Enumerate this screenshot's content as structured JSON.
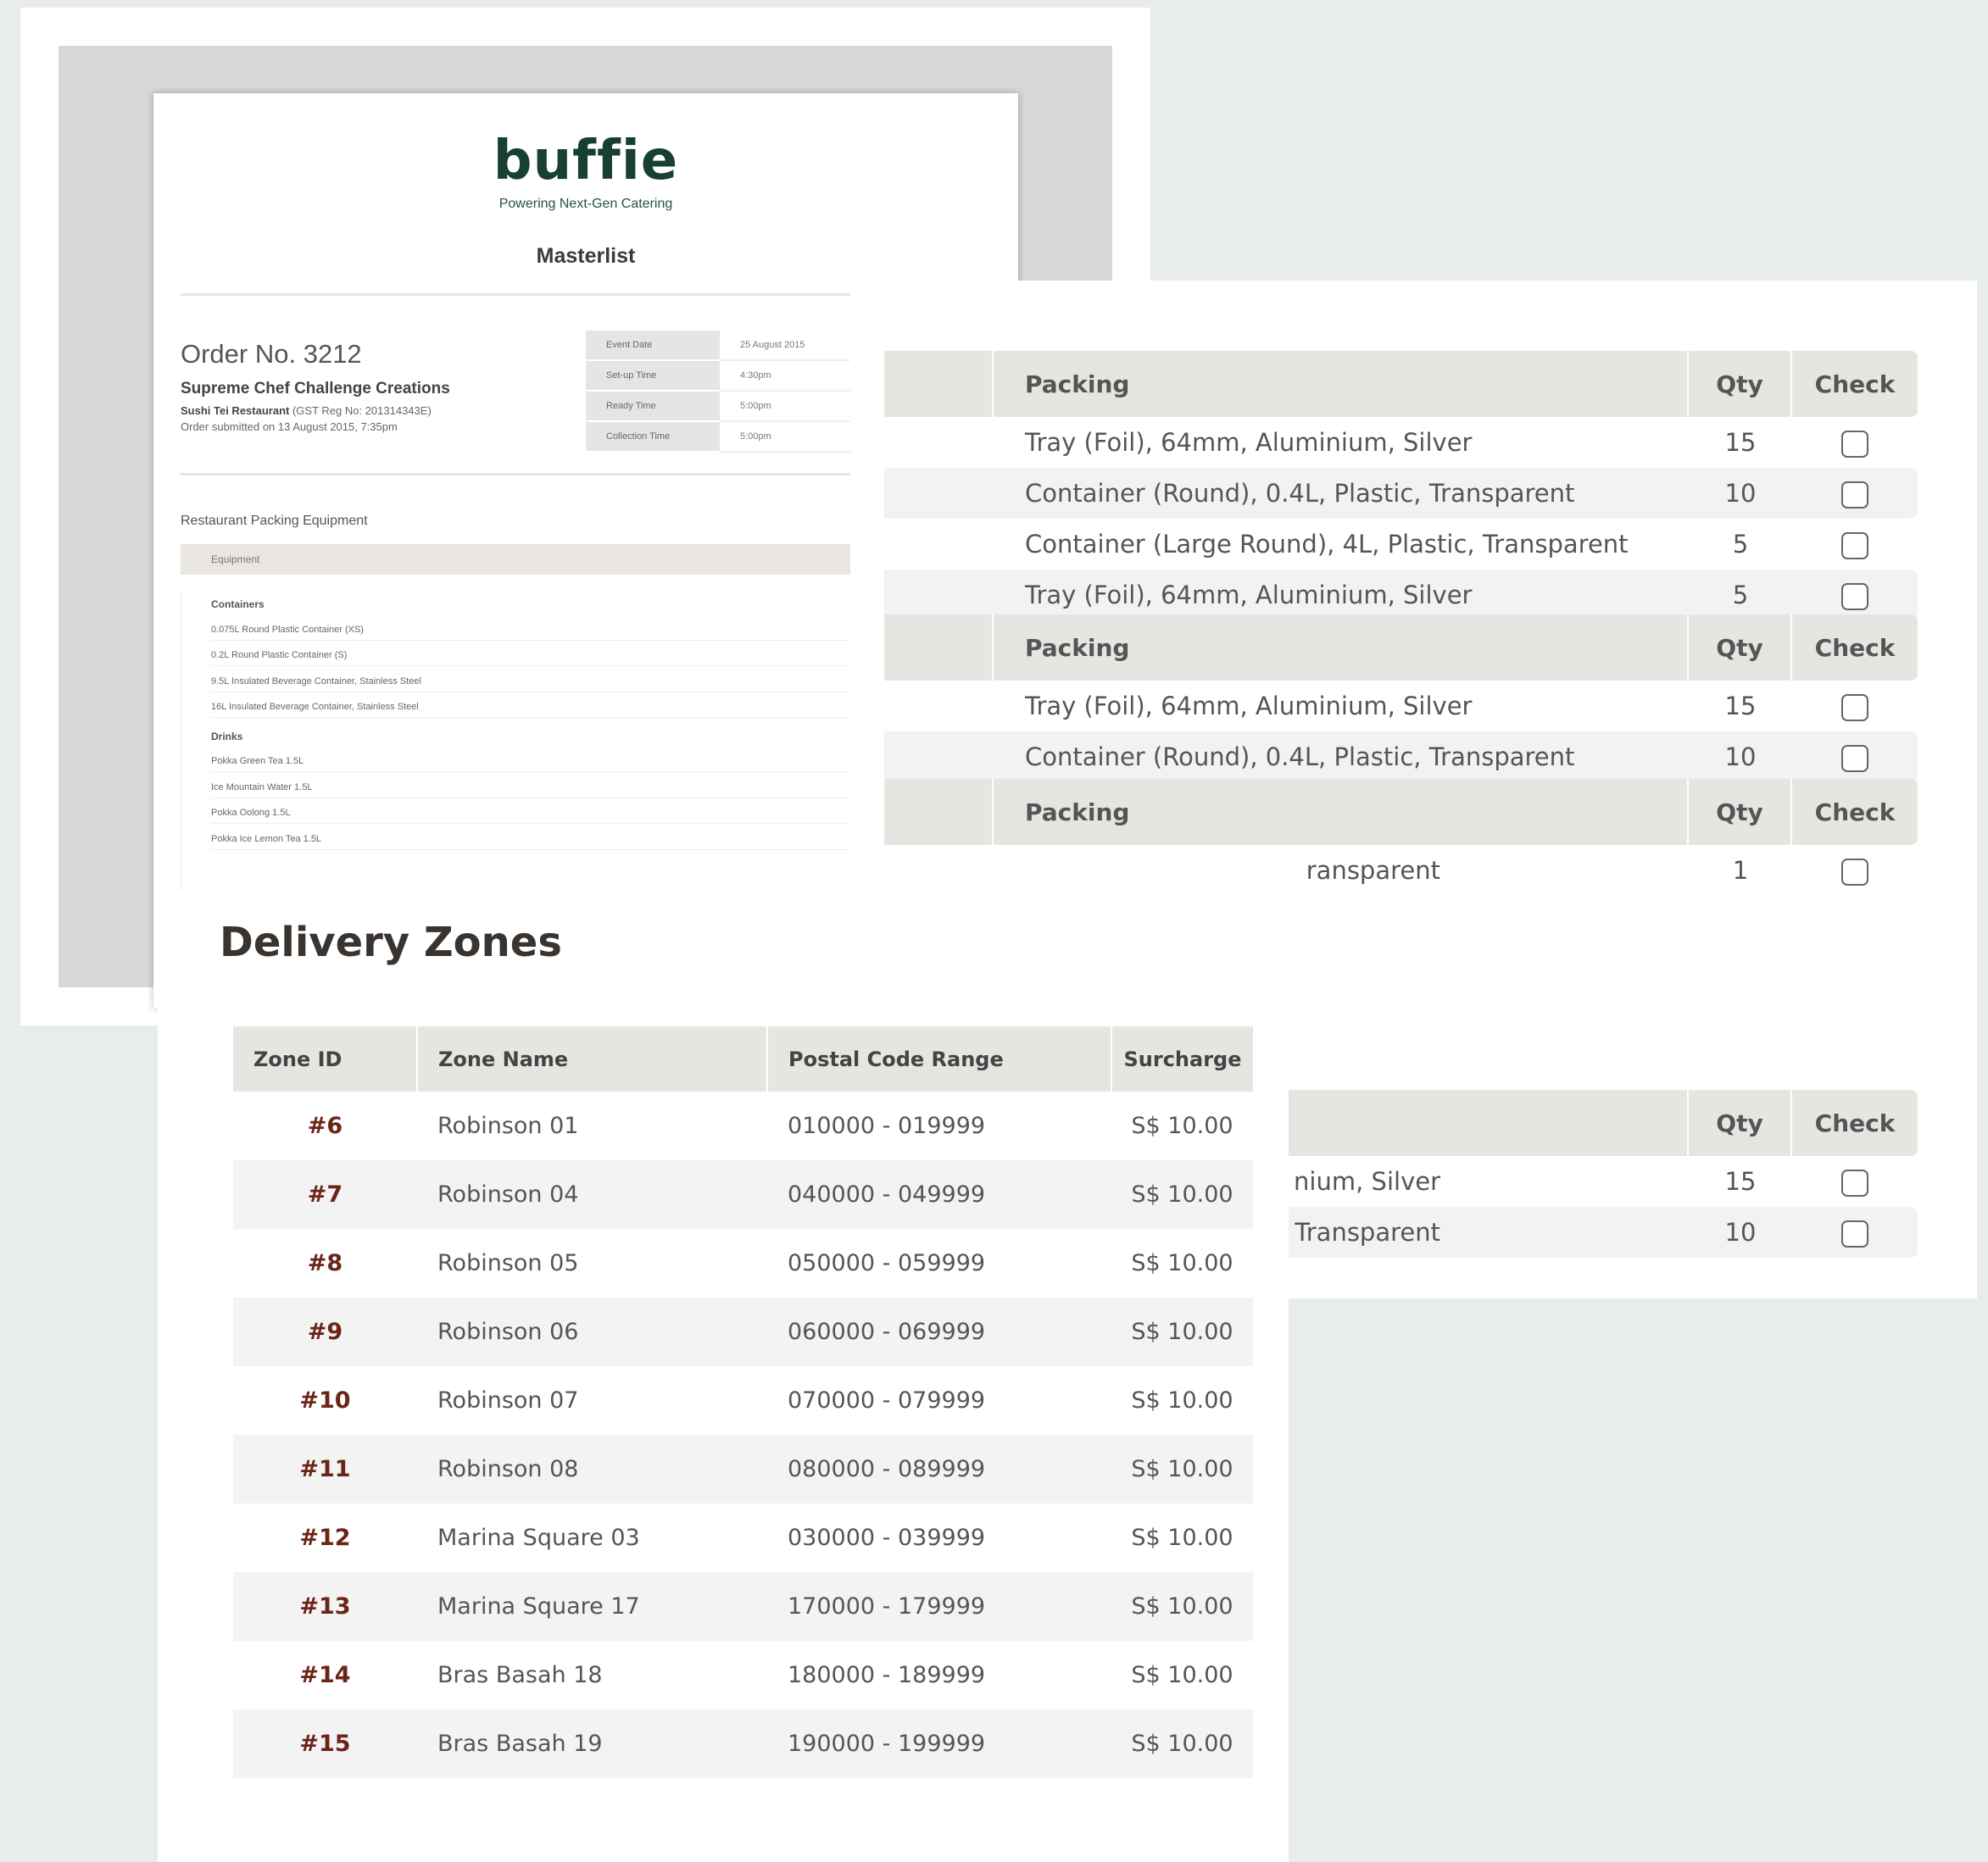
{
  "masterlist": {
    "logo": "buffie",
    "tagline": "Powering Next-Gen Catering",
    "title": "Masterlist",
    "order_no": "Order No. 3212",
    "event_name": "Supreme Chef Challenge Creations",
    "restaurant": "Sushi Tei Restaurant",
    "gst": "(GST Reg No: 201314343E)",
    "submitted": "Order submitted on 13 August 2015, 7:35pm",
    "meta": [
      {
        "label": "Event Date",
        "value": "25 August 2015"
      },
      {
        "label": "Set-up Time",
        "value": "4:30pm"
      },
      {
        "label": "Ready Time",
        "value": "5:00pm"
      },
      {
        "label": "Collection Time",
        "value": "5:00pm"
      }
    ],
    "section_title": "Restaurant Packing Equipment",
    "equipment_header": "Equipment",
    "groups": [
      {
        "name": "Containers",
        "items": [
          "0.075L Round Plastic Container (XS)",
          "0.2L Round Plastic Container (S)",
          "9.5L Insulated Beverage Container, Stainless Steel",
          "16L Insulated Beverage Container, Stainless Steel"
        ]
      },
      {
        "name": "Drinks",
        "items": [
          "Pokka Green Tea 1.5L",
          "Ice Mountain Water 1.5L",
          "Pokka Oolong 1.5L",
          "Pokka Ice Lemon Tea 1.5L"
        ]
      }
    ]
  },
  "packing": {
    "headers": {
      "item": "Packing",
      "qty": "Qty",
      "check": "Check"
    },
    "tables": [
      {
        "rows": [
          {
            "item": "Tray (Foil), 64mm, Aluminium, Silver",
            "qty": "15"
          },
          {
            "item": "Container (Round), 0.4L, Plastic, Transparent",
            "qty": "10"
          },
          {
            "item": "Container (Large Round), 4L, Plastic, Transparent",
            "qty": "5"
          },
          {
            "item": "Tray (Foil), 64mm, Aluminium, Silver",
            "qty": "5"
          }
        ]
      },
      {
        "rows": [
          {
            "item": "Tray (Foil), 64mm, Aluminium, Silver",
            "qty": "15"
          },
          {
            "item": "Container (Round), 0.4L, Plastic, Transparent",
            "qty": "10"
          }
        ]
      },
      {
        "rows": [
          {
            "item": "ransparent",
            "qty": "1"
          }
        ]
      },
      {
        "rows": [
          {
            "item": "nium, Silver",
            "qty": "15"
          },
          {
            "item": "Plastic, Transparent",
            "qty": "10"
          }
        ]
      }
    ]
  },
  "zones": {
    "title": "Delivery Zones",
    "headers": [
      "Zone ID",
      "Zone Name",
      "Postal Code Range",
      "Surcharge"
    ],
    "rows": [
      {
        "id": "#6",
        "name": "Robinson 01",
        "range": "010000 - 019999",
        "surcharge": "S$ 10.00"
      },
      {
        "id": "#7",
        "name": "Robinson 04",
        "range": "040000 - 049999",
        "surcharge": "S$ 10.00"
      },
      {
        "id": "#8",
        "name": "Robinson 05",
        "range": "050000 - 059999",
        "surcharge": "S$ 10.00"
      },
      {
        "id": "#9",
        "name": "Robinson 06",
        "range": "060000 - 069999",
        "surcharge": "S$ 10.00"
      },
      {
        "id": "#10",
        "name": "Robinson 07",
        "range": "070000 - 079999",
        "surcharge": "S$ 10.00"
      },
      {
        "id": "#11",
        "name": "Robinson 08",
        "range": "080000 - 089999",
        "surcharge": "S$ 10.00"
      },
      {
        "id": "#12",
        "name": "Marina Square 03",
        "range": "030000 - 039999",
        "surcharge": "S$ 10.00"
      },
      {
        "id": "#13",
        "name": "Marina Square 17",
        "range": "170000 - 179999",
        "surcharge": "S$ 10.00"
      },
      {
        "id": "#14",
        "name": "Bras Basah 18",
        "range": "180000 - 189999",
        "surcharge": "S$ 10.00"
      },
      {
        "id": "#15",
        "name": "Bras Basah 19",
        "range": "190000 - 199999",
        "surcharge": "S$ 10.00"
      }
    ]
  },
  "colors": {
    "brand_green": "#183f33",
    "zone_id_red": "#6b2416",
    "header_bg": "#e6e5e1",
    "page_bg": "#e9ecec"
  }
}
